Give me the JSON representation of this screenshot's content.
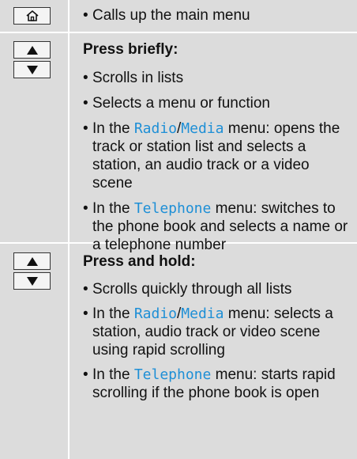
{
  "accent_color": "#1e8fd6",
  "rows": [
    {
      "key_icon": "home-icon",
      "bullet": "Calls up the main menu"
    },
    {
      "key_icons": [
        "arrow-up-icon",
        "arrow-down-icon"
      ],
      "heading": "Press briefly:",
      "items": [
        {
          "text": "Scrolls in lists"
        },
        {
          "text": "Selects a menu or function"
        },
        {
          "pre": "In the ",
          "m1": "Radio",
          "slash": "/",
          "m2": "Media",
          "post": " menu: opens the track or station list and selects a station, an audio track or a video scene"
        },
        {
          "pre": "In the ",
          "m1": "Telephone",
          "post": " menu: switches to the phone book and selects a name or a telephone number"
        }
      ]
    },
    {
      "key_icons": [
        "arrow-up-icon",
        "arrow-down-icon"
      ],
      "heading": "Press and hold:",
      "items": [
        {
          "text": "Scrolls quickly through all lists"
        },
        {
          "pre": "In the ",
          "m1": "Radio",
          "slash": "/",
          "m2": "Media",
          "post": " menu: selects a station, audio track or video scene using rapid scrolling"
        },
        {
          "pre": "In the ",
          "m1": "Telephone",
          "post": " menu: starts rapid scrolling if the phone book is open"
        }
      ]
    }
  ]
}
